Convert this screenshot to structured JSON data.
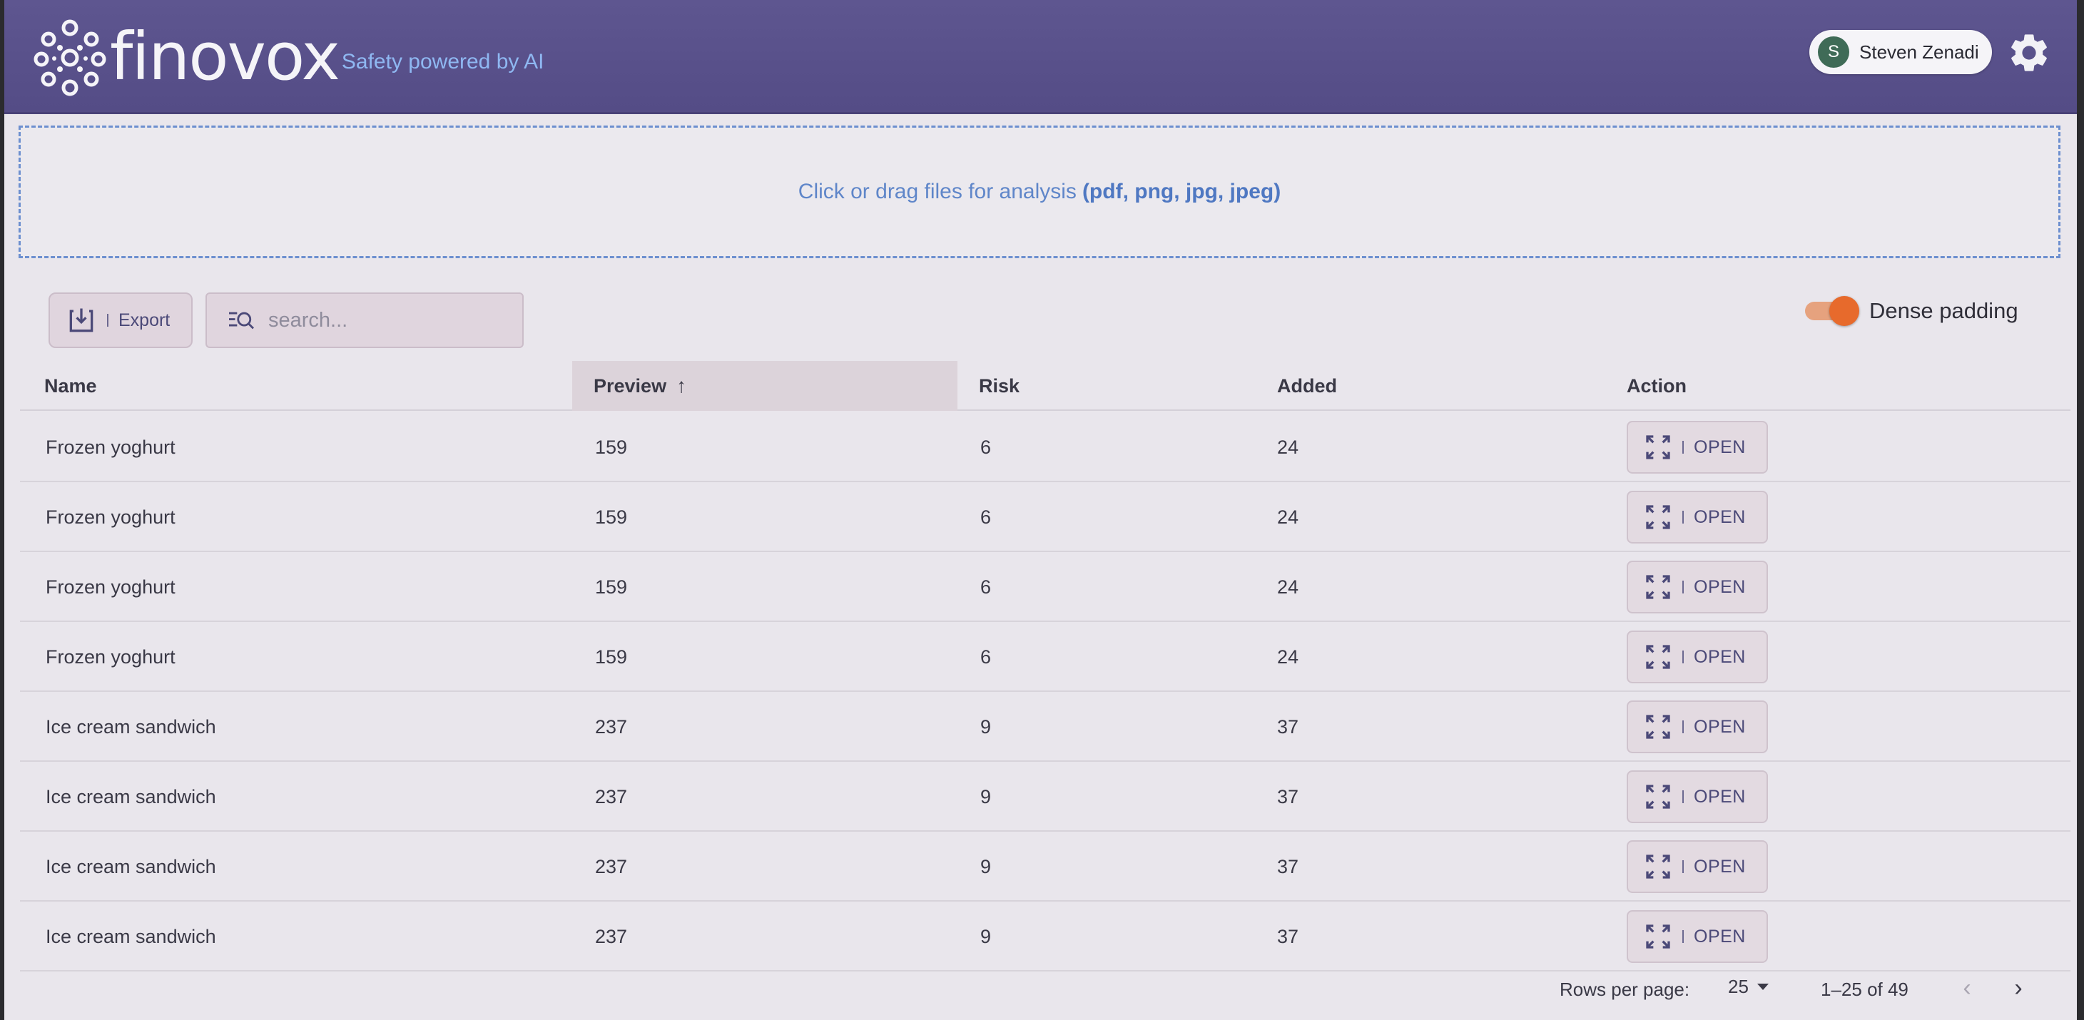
{
  "header": {
    "brand": "finovox",
    "tagline": "Safety powered by AI",
    "user": {
      "initial": "S",
      "name": "Steven Zenadi"
    }
  },
  "dropzone": {
    "text": "Click or drag files for analysis",
    "types": "(pdf, png, jpg, jpeg)"
  },
  "toolbar": {
    "export_label": "Export",
    "search_placeholder": "search...",
    "dense_label": "Dense padding",
    "dense_on": true
  },
  "table": {
    "columns": [
      "Name",
      "Preview",
      "Risk",
      "Added",
      "Action"
    ],
    "sorted_column": "Preview",
    "rows": [
      {
        "name": "Frozen yoghurt",
        "preview": "159",
        "risk": "6",
        "added": "24",
        "action": "OPEN"
      },
      {
        "name": "Frozen yoghurt",
        "preview": "159",
        "risk": "6",
        "added": "24",
        "action": "OPEN"
      },
      {
        "name": "Frozen yoghurt",
        "preview": "159",
        "risk": "6",
        "added": "24",
        "action": "OPEN"
      },
      {
        "name": "Frozen yoghurt",
        "preview": "159",
        "risk": "6",
        "added": "24",
        "action": "OPEN"
      },
      {
        "name": "Ice cream sandwich",
        "preview": "237",
        "risk": "9",
        "added": "37",
        "action": "OPEN"
      },
      {
        "name": "Ice cream sandwich",
        "preview": "237",
        "risk": "9",
        "added": "37",
        "action": "OPEN"
      },
      {
        "name": "Ice cream sandwich",
        "preview": "237",
        "risk": "9",
        "added": "37",
        "action": "OPEN"
      },
      {
        "name": "Ice cream sandwich",
        "preview": "237",
        "risk": "9",
        "added": "37",
        "action": "OPEN"
      }
    ]
  },
  "pagination": {
    "rows_per_page_label": "Rows per page:",
    "rows_per_page": "25",
    "range": "1–25 of 49"
  },
  "colors": {
    "header_bg": "#5a5289",
    "accent": "#e76a2c",
    "link": "#5f86c9"
  }
}
